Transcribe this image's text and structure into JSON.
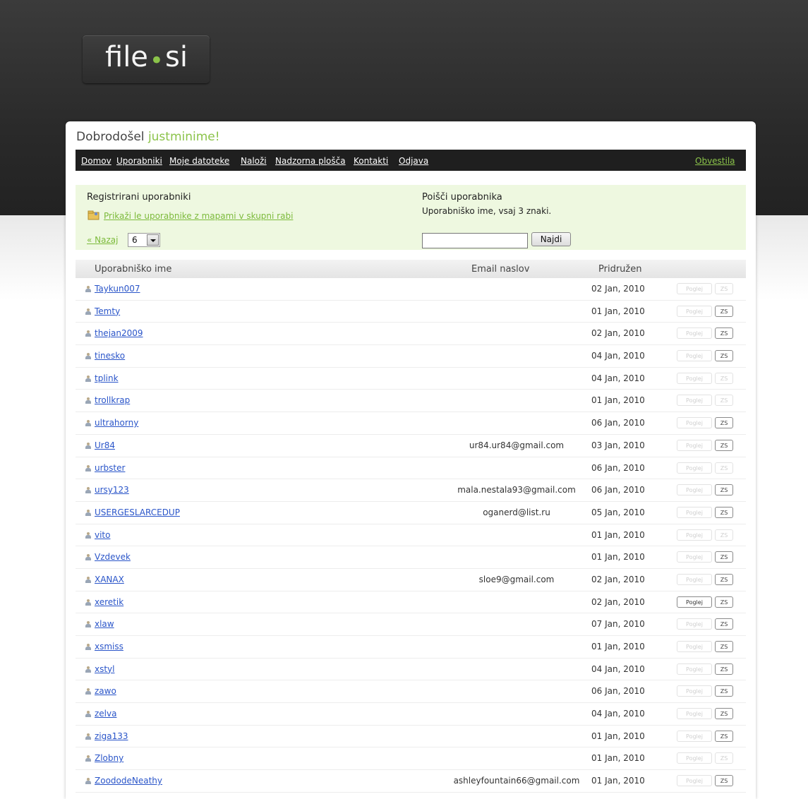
{
  "brand": {
    "logo_left": "file",
    "logo_dot": "•",
    "logo_right": "si"
  },
  "header": {
    "welcome": "Dobrodošel",
    "username": "justminime!"
  },
  "nav": {
    "items": [
      "Domov",
      "Uporabniki",
      "Moje datoteke",
      "Naloži",
      "Nadzorna plošča",
      "Kontakti",
      "Odjava"
    ],
    "notifications": "Obvestila"
  },
  "registered": {
    "title": "Registrirani uporabniki",
    "shared_folders_link": "Prikaži le uporabnike z mapami v skupni rabi",
    "back_link": "« Nazaj",
    "page_value": "6"
  },
  "search": {
    "title": "Poišči uporabnika",
    "hint": "Uporabniško ime, vsaj 3 znaki.",
    "input_value": "",
    "button_label": "Najdi"
  },
  "table": {
    "columns": [
      "Uporabniško ime",
      "Email naslov",
      "Pridružen"
    ],
    "view_label": "Poglej",
    "zs_label": "ZS",
    "rows": [
      {
        "user": "Taykun007",
        "email": "",
        "date": "02 Jan, 2010",
        "view_active": false,
        "zs_active": false
      },
      {
        "user": "Temty",
        "email": "",
        "date": "01 Jan, 2010",
        "view_active": false,
        "zs_active": true
      },
      {
        "user": "thejan2009",
        "email": "",
        "date": "02 Jan, 2010",
        "view_active": false,
        "zs_active": true
      },
      {
        "user": "tinesko",
        "email": "",
        "date": "04 Jan, 2010",
        "view_active": false,
        "zs_active": true
      },
      {
        "user": "tplink",
        "email": "",
        "date": "04 Jan, 2010",
        "view_active": false,
        "zs_active": false
      },
      {
        "user": "trollkrap",
        "email": "",
        "date": "01 Jan, 2010",
        "view_active": false,
        "zs_active": false
      },
      {
        "user": "ultrahorny",
        "email": "",
        "date": "06 Jan, 2010",
        "view_active": false,
        "zs_active": true
      },
      {
        "user": "Ur84",
        "email": "ur84.ur84@gmail.com",
        "date": "03 Jan, 2010",
        "view_active": false,
        "zs_active": true
      },
      {
        "user": "urbster",
        "email": "",
        "date": "06 Jan, 2010",
        "view_active": false,
        "zs_active": false
      },
      {
        "user": "ursy123",
        "email": "mala.nestala93@gmail.com",
        "date": "06 Jan, 2010",
        "view_active": false,
        "zs_active": true
      },
      {
        "user": "USERGESLARCEDUP",
        "email": "oganerd@list.ru",
        "date": "05 Jan, 2010",
        "view_active": false,
        "zs_active": true
      },
      {
        "user": "vito",
        "email": "",
        "date": "01 Jan, 2010",
        "view_active": false,
        "zs_active": false
      },
      {
        "user": "Vzdevek",
        "email": "",
        "date": "01 Jan, 2010",
        "view_active": false,
        "zs_active": true
      },
      {
        "user": "XANAX",
        "email": "sloe9@gmail.com",
        "date": "02 Jan, 2010",
        "view_active": false,
        "zs_active": true
      },
      {
        "user": "xeretik",
        "email": "",
        "date": "02 Jan, 2010",
        "view_active": true,
        "zs_active": true
      },
      {
        "user": "xlaw",
        "email": "",
        "date": "07 Jan, 2010",
        "view_active": false,
        "zs_active": true
      },
      {
        "user": "xsmiss",
        "email": "",
        "date": "01 Jan, 2010",
        "view_active": false,
        "zs_active": true
      },
      {
        "user": "xstyl",
        "email": "",
        "date": "04 Jan, 2010",
        "view_active": false,
        "zs_active": true
      },
      {
        "user": "zawo",
        "email": "",
        "date": "06 Jan, 2010",
        "view_active": false,
        "zs_active": true
      },
      {
        "user": "zelva",
        "email": "",
        "date": "04 Jan, 2010",
        "view_active": false,
        "zs_active": true
      },
      {
        "user": "ziga133",
        "email": "",
        "date": "01 Jan, 2010",
        "view_active": false,
        "zs_active": true
      },
      {
        "user": "Zlobny",
        "email": "",
        "date": "01 Jan, 2010",
        "view_active": false,
        "zs_active": false
      },
      {
        "user": "ZoododeNeathy",
        "email": "ashleyfountain66@gmail.com",
        "date": "01 Jan, 2010",
        "view_active": false,
        "zs_active": true
      }
    ]
  },
  "colors": {
    "accent_green": "#8bc34a",
    "link_blue": "#2a55c9",
    "nav_bg": "#1f1f1f",
    "green_box_bg": "#eef8e0"
  }
}
